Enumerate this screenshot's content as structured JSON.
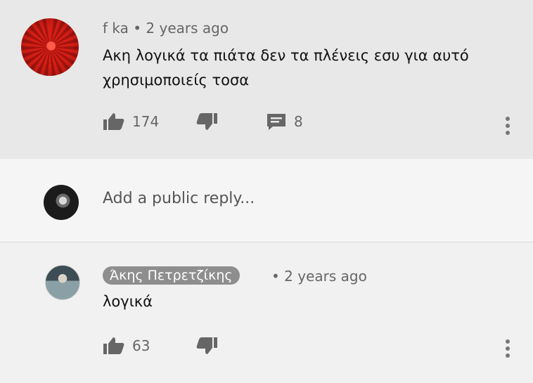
{
  "comment": {
    "author": "f ka",
    "time": "2 years ago",
    "text_line1": "Ακη λογικά τα πιάτα δεν τα πλένεις εσυ για αυτό",
    "text_line2": "χρησιμοποιείς τοσα",
    "likes": "174",
    "replies": "8",
    "icons": [
      "like-icon",
      "dislike-icon",
      "reply-comment-icon",
      "more-options-icon"
    ]
  },
  "reply_box": {
    "placeholder": "Add a public reply..."
  },
  "reply": {
    "author": "Άκης Πετρετζίκης",
    "time": "2 years ago",
    "text": "λογικά",
    "likes": "63"
  },
  "colors": {
    "top_background": "#e8e8e8",
    "badge_background": "#8e8e8e",
    "icon_gray": "#666666"
  }
}
